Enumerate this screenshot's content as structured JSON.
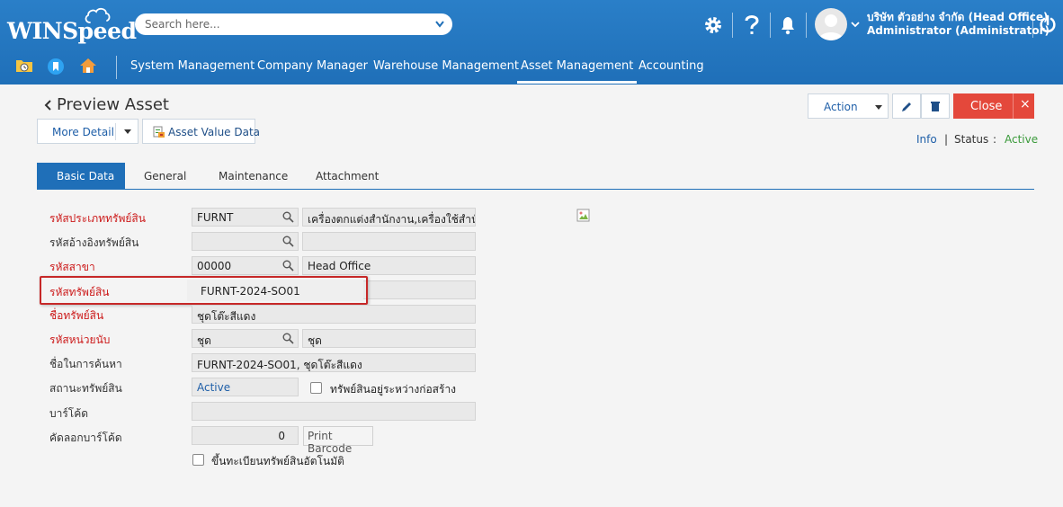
{
  "header": {
    "logo_text": "WINSpeed",
    "search_placeholder": "Search here...",
    "company_name": "บริษัท ตัวอย่าง จำกัด (Head Office)",
    "user_name": "Administrator (Administrator)"
  },
  "nav": {
    "menus": [
      "System Management",
      "Company Manager",
      "Warehouse Management",
      "Asset Management",
      "Accounting"
    ],
    "active_menu": "Asset Management"
  },
  "page": {
    "title": "Preview Asset",
    "more_detail_label": "More Detail",
    "asset_value_label": "Asset Value Data",
    "action_label": "Action",
    "close_label": "Close",
    "close_x": "×",
    "info_label": "Info",
    "status_label": "Status",
    "status_colon": ":",
    "status_value": "Active",
    "separator": "|"
  },
  "tabs": [
    "Basic Data",
    "General",
    "Maintenance",
    "Attachment"
  ],
  "form": {
    "asset_type_code_label": "รหัสประเภททรัพย์สิน",
    "asset_type_code": "FURNT",
    "asset_type_name": "เครื่องตกแต่งสำนักงาน,เครื่องใช้สำนั",
    "ref_code_label": "รหัสอ้างอิงทรัพย์สิน",
    "branch_code_label": "รหัสสาขา",
    "branch_code": "00000",
    "branch_name": "Head Office",
    "asset_code_label": "รหัสทรัพย์สิน",
    "asset_code": "FURNT-2024-SO01",
    "asset_name_label": "ชื่อทรัพย์สิน",
    "asset_name": "ชุดโต๊ะสีแดง",
    "unit_code_label": "รหัสหน่วยนับ",
    "unit_code": "ชุด",
    "unit_name": "ชุด",
    "search_name_label": "ชื่อในการค้นหา",
    "search_name": "FURNT-2024-SO01, ชุดโต๊ะสีแดง",
    "asset_status_label": "สถานะทรัพย์สิน",
    "asset_status": "Active",
    "under_construction_label": "ทรัพย์สินอยู่ระหว่างก่อสร้าง",
    "barcode_label": "บาร์โค้ด",
    "copy_barcode_label": "คัดลอกบาร์โค้ด",
    "copy_barcode_value": "0",
    "print_barcode_label": "Print Barcode",
    "auto_register_label": "ขึ้นทะเบียนทรัพย์สินอัตโนมัติ"
  },
  "colors": {
    "header_blue": "#1f6fb8",
    "close_red": "#e4483b",
    "required_red": "#cc1a1a",
    "status_green": "#3a9a3a"
  }
}
